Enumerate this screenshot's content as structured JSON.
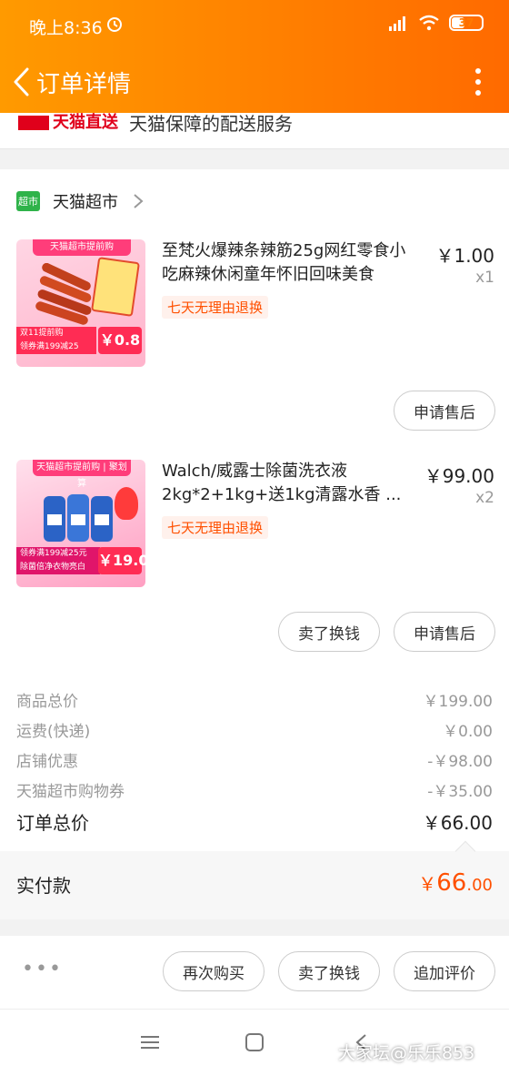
{
  "status": {
    "time": "晚上8:36",
    "battery": "37"
  },
  "header": {
    "title": "订单详情"
  },
  "delivery": {
    "logo": "天猫直送",
    "text": "天猫保障的配送服务"
  },
  "shop": {
    "badge": "超市",
    "name": "天猫超市"
  },
  "items": [
    {
      "title": "至梵火爆辣条辣筋25g网红零食小吃麻辣休闲童年怀旧回味美食",
      "price": "￥1.00",
      "qty": "x1",
      "tag": "七天无理由退换",
      "thumb": {
        "banner": "天猫超市提前购",
        "coupon_a": "双11提前购",
        "coupon_b": "领券满199减25",
        "price": "￥0.8"
      },
      "actions": [
        "申请售后"
      ]
    },
    {
      "title": "Walch/威露士除菌洗衣液2kg*2+1kg+送1kg清露水香 ...",
      "price": "￥99.00",
      "qty": "x2",
      "tag": "七天无理由退换",
      "thumb": {
        "banner": "天猫超市提前购 | 聚划算",
        "coupon_a": "领券满199减25元",
        "coupon_b": "除菌倍净衣物亮白",
        "price": "￥19.0"
      },
      "actions": [
        "卖了换钱",
        "申请售后"
      ]
    }
  ],
  "summary": {
    "rows": [
      {
        "label": "商品总价",
        "value": "￥199.00"
      },
      {
        "label": "运费(快递)",
        "value": "￥0.00"
      },
      {
        "label": "店铺优惠",
        "value": "-￥98.00"
      },
      {
        "label": "天猫超市购物券",
        "value": "-￥35.00"
      }
    ],
    "total_label": "订单总价",
    "total_value": "￥66.00"
  },
  "paid": {
    "label": "实付款",
    "currency": "￥",
    "integer": "66",
    "decimal": ".00"
  },
  "bottom_actions": {
    "more": "•••",
    "buttons": [
      "再次购买",
      "卖了换钱",
      "追加评价"
    ]
  },
  "watermark": "大家坛@乐乐853",
  "colors": {
    "accent": "#ff5000",
    "header_start": "#ff9a00",
    "header_end": "#ff6a00"
  }
}
